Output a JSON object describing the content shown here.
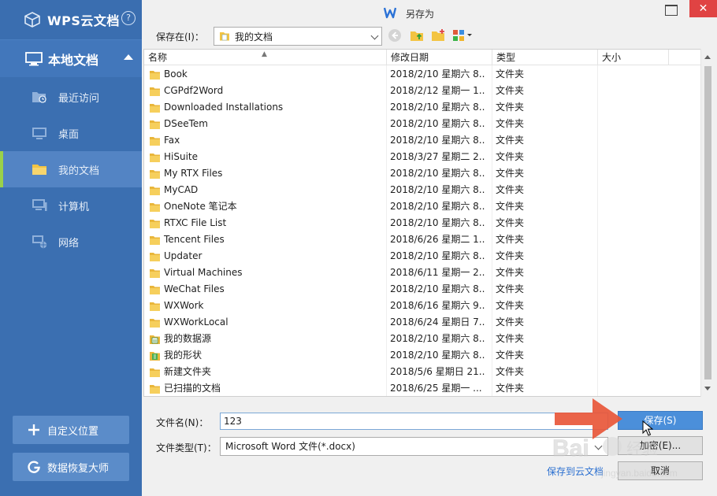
{
  "sidebar": {
    "brand": "WPS云文档",
    "help": "?",
    "local_docs": "本地文档",
    "items": [
      {
        "label": "最近访问",
        "icon": "recent-folder-icon",
        "active": false
      },
      {
        "label": "桌面",
        "icon": "desktop-icon",
        "active": false
      },
      {
        "label": "我的文档",
        "icon": "folder-icon",
        "active": true
      },
      {
        "label": "计算机",
        "icon": "computer-icon",
        "active": false
      },
      {
        "label": "网络",
        "icon": "network-icon",
        "active": false
      }
    ],
    "custom_location": "自定义位置",
    "recovery": "数据恢复大师"
  },
  "dialog": {
    "title": "另存为",
    "save_in_label": "保存在(I)：",
    "save_in_value": "我的文档",
    "close": "✕",
    "columns": {
      "name": "名称",
      "date": "修改日期",
      "type": "类型",
      "size": "大小"
    },
    "files": [
      {
        "name": "Book",
        "date": "2018/2/10 星期六 8...",
        "type": "文件夹",
        "icon": "folder"
      },
      {
        "name": "CGPdf2Word",
        "date": "2018/2/12 星期一 1...",
        "type": "文件夹",
        "icon": "folder"
      },
      {
        "name": "Downloaded Installations",
        "date": "2018/2/10 星期六 8...",
        "type": "文件夹",
        "icon": "folder"
      },
      {
        "name": "DSeeTem",
        "date": "2018/2/10 星期六 8...",
        "type": "文件夹",
        "icon": "folder"
      },
      {
        "name": "Fax",
        "date": "2018/2/10 星期六 8...",
        "type": "文件夹",
        "icon": "folder"
      },
      {
        "name": "HiSuite",
        "date": "2018/3/27 星期二 2...",
        "type": "文件夹",
        "icon": "folder"
      },
      {
        "name": "My RTX Files",
        "date": "2018/2/10 星期六 8...",
        "type": "文件夹",
        "icon": "folder"
      },
      {
        "name": "MyCAD",
        "date": "2018/2/10 星期六 8...",
        "type": "文件夹",
        "icon": "folder"
      },
      {
        "name": "OneNote 笔记本",
        "date": "2018/2/10 星期六 8...",
        "type": "文件夹",
        "icon": "folder"
      },
      {
        "name": "RTXC File List",
        "date": "2018/2/10 星期六 8...",
        "type": "文件夹",
        "icon": "folder"
      },
      {
        "name": "Tencent Files",
        "date": "2018/6/26 星期二 1...",
        "type": "文件夹",
        "icon": "folder"
      },
      {
        "name": "Updater",
        "date": "2018/2/10 星期六 8...",
        "type": "文件夹",
        "icon": "folder"
      },
      {
        "name": "Virtual Machines",
        "date": "2018/6/11 星期一 2...",
        "type": "文件夹",
        "icon": "folder"
      },
      {
        "name": "WeChat Files",
        "date": "2018/2/10 星期六 8...",
        "type": "文件夹",
        "icon": "folder"
      },
      {
        "name": "WXWork",
        "date": "2018/6/16 星期六 9...",
        "type": "文件夹",
        "icon": "folder"
      },
      {
        "name": "WXWorkLocal",
        "date": "2018/6/24 星期日 7...",
        "type": "文件夹",
        "icon": "folder"
      },
      {
        "name": "我的数据源",
        "date": "2018/2/10 星期六 8...",
        "type": "文件夹",
        "icon": "datasource"
      },
      {
        "name": "我的形状",
        "date": "2018/2/10 星期六 8...",
        "type": "文件夹",
        "icon": "shapes"
      },
      {
        "name": "新建文件夹",
        "date": "2018/5/6 星期日 21...",
        "type": "文件夹",
        "icon": "folder"
      },
      {
        "name": "已扫描的文档",
        "date": "2018/6/25 星期一 ...",
        "type": "文件夹",
        "icon": "folder"
      }
    ],
    "filename_label": "文件名(N)：",
    "filename_value": "123",
    "filetype_label": "文件类型(T)：",
    "filetype_value": "Microsoft Word 文件(*.docx)",
    "save_button": "保存(S)",
    "encrypt_button": "加密(E)...",
    "cancel_button": "取消",
    "cloud_link": "保存到云文档"
  },
  "watermark": {
    "text": "Bai 经验",
    "sub": "jingyan.baidu.com"
  },
  "colors": {
    "sidebar": "#3b6fb1",
    "accent_green": "#9ad14a",
    "primary_button": "#4b8fda",
    "arrow": "#e8573a"
  }
}
